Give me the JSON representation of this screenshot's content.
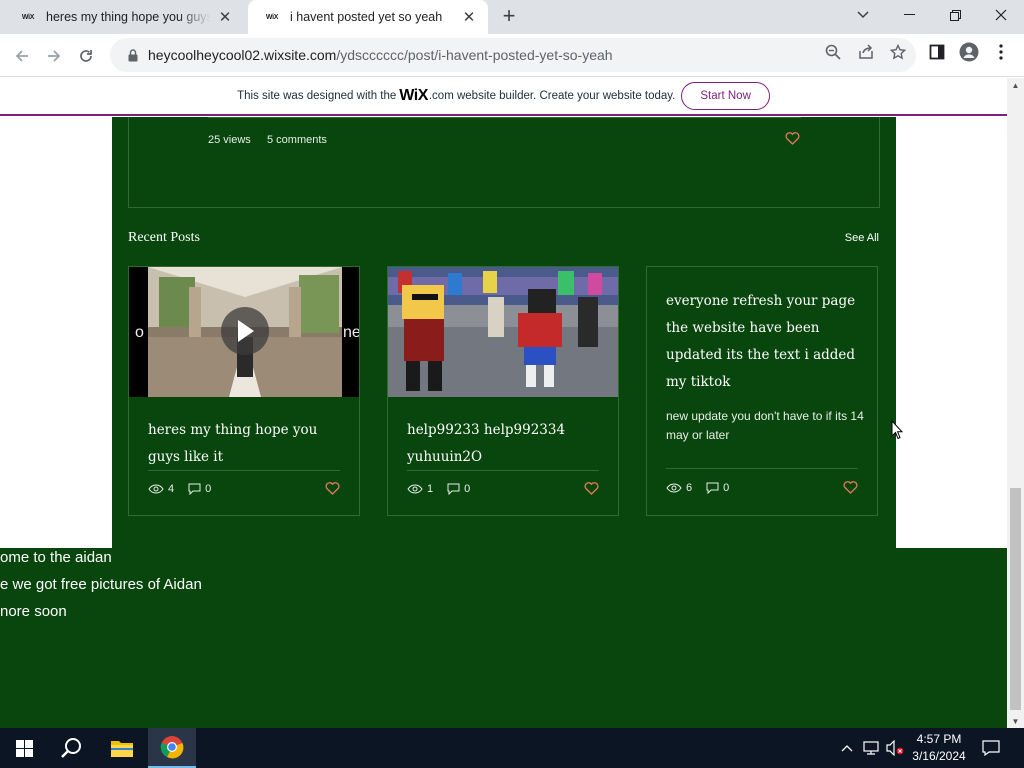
{
  "tabs": [
    {
      "favicon": "WiX",
      "title": "heres my thing hope you guys like it"
    },
    {
      "favicon": "WiX",
      "title": "i havent posted yet so yeah"
    }
  ],
  "address": {
    "domain": "heycoolheycool02.wixsite.com",
    "path": "/ydscccccc/post/i-havent-posted-yet-so-yeah"
  },
  "wix_banner": {
    "text_before": "This site was designed with the",
    "logo": "WiX",
    "text_after": ".com website builder. Create your website today.",
    "button": "Start Now"
  },
  "post_stats": {
    "views": "25 views",
    "comments": "5 comments"
  },
  "recent": {
    "title": "Recent Posts",
    "see_all": "See All",
    "cards": [
      {
        "title": "heres my thing hope you guys like it",
        "views": "4",
        "comments": "0"
      },
      {
        "title": "help99233 help992334 yuhuuin2O",
        "views": "1",
        "comments": "0"
      },
      {
        "title": "everyone refresh your page the website have been updated its the text i added my tiktok",
        "desc": "new update you don't have to if its 14 may or later",
        "views": "6",
        "comments": "0"
      }
    ]
  },
  "bottom_lines": [
    "ome to the aidan",
    "e we got free pictures of Aidan",
    "nore soon"
  ],
  "taskbar": {
    "time": "4:57 PM",
    "date": "3/16/2024"
  },
  "colors": {
    "site_green": "#08460e",
    "wix_purple": "#7e1f7d",
    "heart": "#e07a5f"
  }
}
